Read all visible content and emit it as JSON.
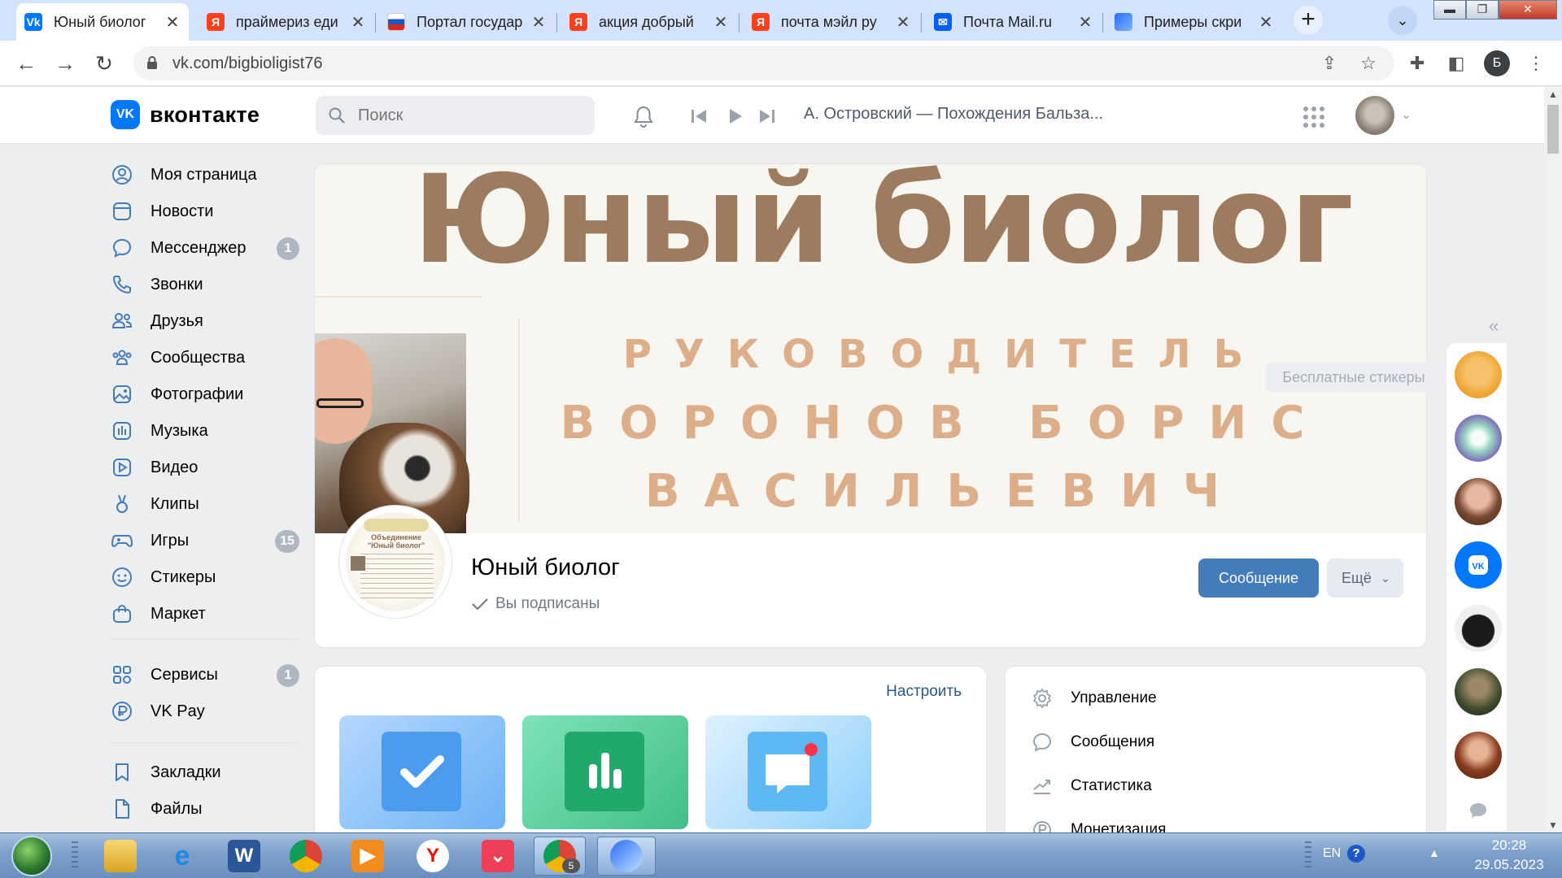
{
  "browser": {
    "tabs": [
      {
        "title": "Юный биолог",
        "favicon": "vk-icon",
        "active": true
      },
      {
        "title": "праймериз еди",
        "favicon": "yandex-icon",
        "active": false
      },
      {
        "title": "Портал государ",
        "favicon": "gosuslugi-icon",
        "active": false
      },
      {
        "title": "акция добрый",
        "favicon": "yandex-icon",
        "active": false
      },
      {
        "title": "почта мэйл ру",
        "favicon": "yandex-icon",
        "active": false
      },
      {
        "title": "Почта Mail.ru",
        "favicon": "mail-icon",
        "active": false
      },
      {
        "title": "Примеры скри",
        "favicon": "lightshot-icon",
        "active": false
      }
    ],
    "url": "vk.com/bigbioligist76",
    "profile_initial": "Б"
  },
  "vk": {
    "logo_text": "вконтакте",
    "search_placeholder": "Поиск",
    "now_playing": "А. Островский — Похождения Бальза...",
    "nav": [
      {
        "label": "Моя страница",
        "icon": "profile-icon"
      },
      {
        "label": "Новости",
        "icon": "news-icon"
      },
      {
        "label": "Мессенджер",
        "icon": "messenger-icon",
        "badge": "1"
      },
      {
        "label": "Звонки",
        "icon": "phone-icon"
      },
      {
        "label": "Друзья",
        "icon": "friends-icon"
      },
      {
        "label": "Сообщества",
        "icon": "communities-icon"
      },
      {
        "label": "Фотографии",
        "icon": "photos-icon"
      },
      {
        "label": "Музыка",
        "icon": "music-icon"
      },
      {
        "label": "Видео",
        "icon": "video-icon"
      },
      {
        "label": "Клипы",
        "icon": "clips-icon"
      },
      {
        "label": "Игры",
        "icon": "games-icon",
        "badge": "15"
      },
      {
        "label": "Стикеры",
        "icon": "stickers-icon"
      },
      {
        "label": "Маркет",
        "icon": "market-icon"
      }
    ],
    "nav_secondary": [
      {
        "label": "Сервисы",
        "icon": "services-icon",
        "badge": "1"
      },
      {
        "label": "VK Pay",
        "icon": "vkpay-icon"
      }
    ],
    "nav_tertiary": [
      {
        "label": "Закладки",
        "icon": "bookmarks-icon"
      },
      {
        "label": "Файлы",
        "icon": "files-icon"
      }
    ]
  },
  "group": {
    "cover": {
      "title": "Юный биолог",
      "line1": "РУКОВОДИТЕЛЬ",
      "line2": "ВОРОНОВ БОРИС",
      "line3": "ВАСИЛЬЕВИЧ"
    },
    "avatar_text": "Объединение \"Юный биолог\"",
    "name": "Юный биолог",
    "status": "Вы подписаны",
    "message_button": "Сообщение",
    "more_button": "Ещё",
    "configure_link": "Настроить",
    "manage_items": [
      {
        "label": "Управление",
        "icon": "gear-icon"
      },
      {
        "label": "Сообщения",
        "icon": "message-bubble-icon"
      },
      {
        "label": "Статистика",
        "icon": "statistics-icon"
      },
      {
        "label": "Монетизация",
        "icon": "monetization-icon"
      }
    ]
  },
  "rail": {
    "tooltip": "Бесплатные стикеры"
  },
  "taskbar": {
    "language": "EN",
    "chrome_badge": "5",
    "time": "20:28",
    "date": "29.05.2023"
  },
  "colors": {
    "vk_blue": "#0077ff",
    "message_button": "#447bba",
    "cover_title": "#9c7b5f",
    "cover_text": "#dcae89",
    "tab_strip": "#d3e3fd"
  }
}
